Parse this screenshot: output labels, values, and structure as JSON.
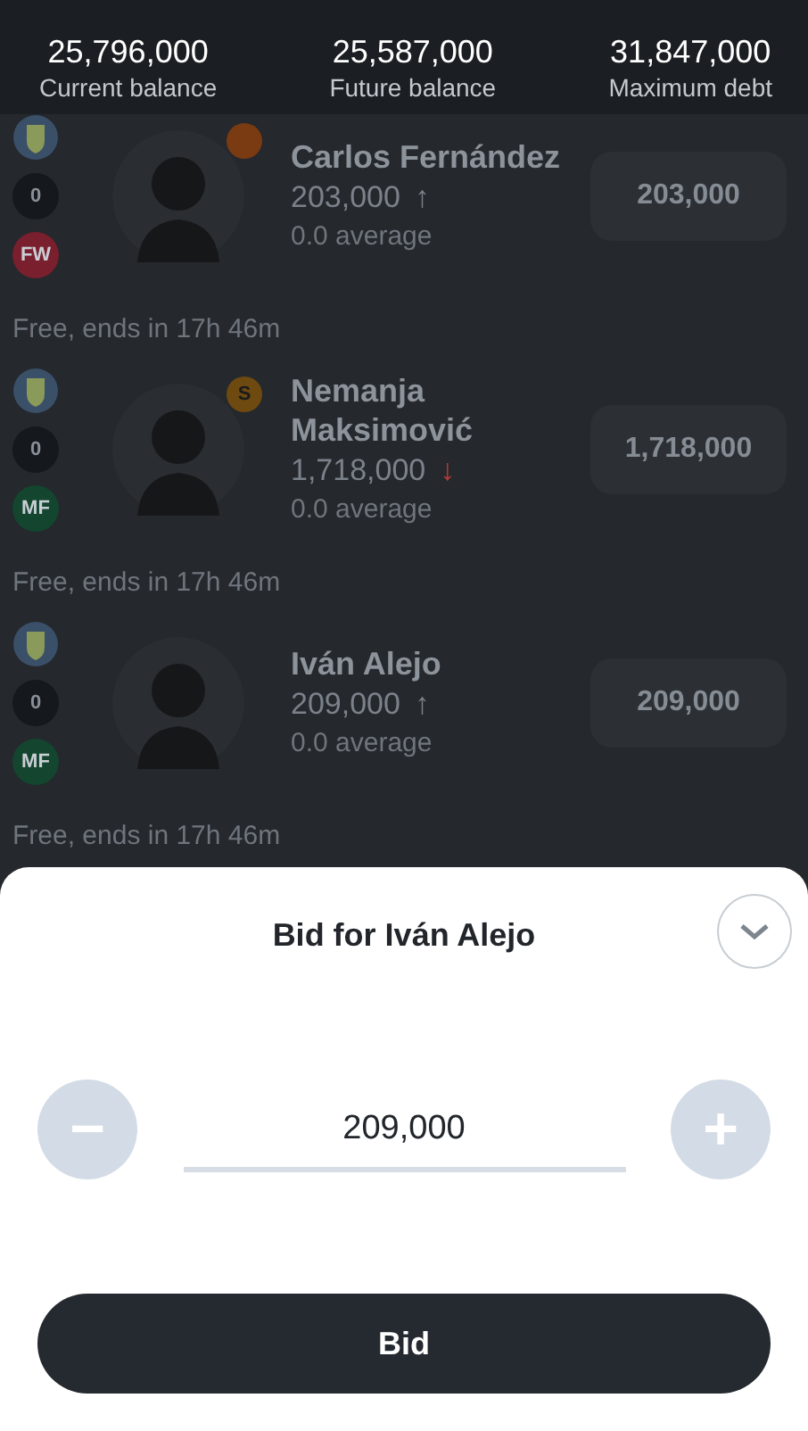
{
  "balances": [
    {
      "value": "25,796,000",
      "label": "Current balance"
    },
    {
      "value": "25,587,000",
      "label": "Future balance"
    },
    {
      "value": "31,847,000",
      "label": "Maximum debt"
    }
  ],
  "players": [
    {
      "name": "Carlos Fernández",
      "price": "203,000",
      "arrow": {
        "text": "↑",
        "color": "#7b818a"
      },
      "average": "0.0 average",
      "points": "0",
      "position": {
        "text": "FW",
        "color": "#7a1f2e"
      },
      "badge": {
        "color": "#7a3a12"
      },
      "bid_amount": "203,000",
      "status": "Free, ends in 17h 46m"
    },
    {
      "name": "Nemanja Maksimović",
      "price": "1,718,000",
      "arrow": {
        "text": "↓",
        "color": "#b83a3a"
      },
      "average": "0.0 average",
      "points": "0",
      "position": {
        "text": "MF",
        "color": "#13452f"
      },
      "badge": {
        "color": "#6e4a10",
        "text": "S"
      },
      "bid_amount": "1,718,000",
      "status": "Free, ends in 17h 46m"
    },
    {
      "name": "Iván Alejo",
      "price": "209,000",
      "arrow": {
        "text": "↑",
        "color": "#7b818a"
      },
      "average": "0.0 average",
      "points": "0",
      "position": {
        "text": "MF",
        "color": "#13452f"
      },
      "bid_amount": "209,000",
      "status": "Free, ends in 17h 46m"
    }
  ],
  "sheet": {
    "title": "Bid for Iván Alejo",
    "value": "209,000",
    "minus": "−",
    "plus": "+",
    "button": "Bid"
  }
}
